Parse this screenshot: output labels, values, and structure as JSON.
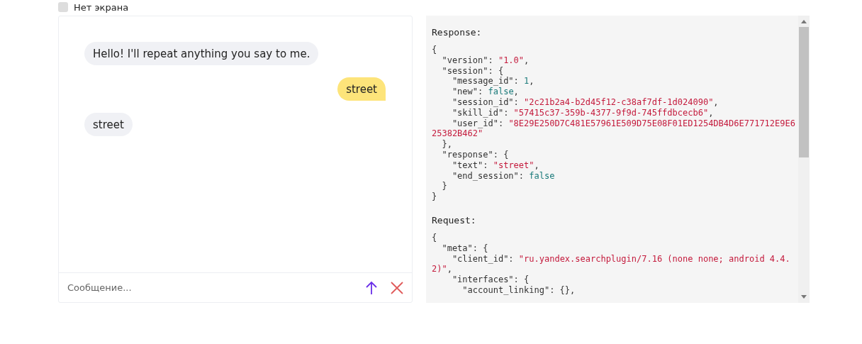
{
  "no_screen_option": {
    "label": "Нет экрана",
    "checked": false
  },
  "chat": {
    "messages": [
      {
        "kind": "skill",
        "text": "Hello! I'll repeat anything you say to me."
      },
      {
        "kind": "user",
        "text": "street"
      },
      {
        "kind": "skill",
        "text": "street"
      }
    ],
    "input": {
      "placeholder": "Сообщение..."
    }
  },
  "log": {
    "sections": [
      {
        "title": "Response:",
        "lines": [
          [
            {
              "kind": "punct",
              "text": "{"
            }
          ],
          [
            {
              "kind": "punct",
              "text": "  \"version\": "
            },
            {
              "kind": "string",
              "text": "\"1.0\""
            },
            {
              "kind": "punct",
              "text": ","
            }
          ],
          [
            {
              "kind": "punct",
              "text": "  \"session\": {"
            }
          ],
          [
            {
              "kind": "punct",
              "text": "    \"message_id\": "
            },
            {
              "kind": "number",
              "text": "1"
            },
            {
              "kind": "punct",
              "text": ","
            }
          ],
          [
            {
              "kind": "punct",
              "text": "    \"new\": "
            },
            {
              "kind": "bool",
              "text": "false"
            },
            {
              "kind": "punct",
              "text": ","
            }
          ],
          [
            {
              "kind": "punct",
              "text": "    \"session_id\": "
            },
            {
              "kind": "string",
              "text": "\"2c21b2a4-b2d45f12-c38af7df-1d024090\""
            },
            {
              "kind": "punct",
              "text": ","
            }
          ],
          [
            {
              "kind": "punct",
              "text": "    \"skill_id\": "
            },
            {
              "kind": "string",
              "text": "\"57415c37-359b-4377-9f9d-745ffdbcecb6\""
            },
            {
              "kind": "punct",
              "text": ","
            }
          ],
          [
            {
              "kind": "punct",
              "text": "    \"user_id\": "
            },
            {
              "kind": "string",
              "text": "\"8E29E250D7C481E57961E509D75E08F01ED1254DB4D6E771712E9E6"
            }
          ],
          [
            {
              "kind": "string",
              "text": "25382B462\""
            }
          ],
          [
            {
              "kind": "punct",
              "text": "  },"
            }
          ],
          [
            {
              "kind": "punct",
              "text": "  \"response\": {"
            }
          ],
          [
            {
              "kind": "punct",
              "text": "    \"text\": "
            },
            {
              "kind": "string",
              "text": "\"street\""
            },
            {
              "kind": "punct",
              "text": ","
            }
          ],
          [
            {
              "kind": "punct",
              "text": "    \"end_session\": "
            },
            {
              "kind": "bool",
              "text": "false"
            }
          ],
          [
            {
              "kind": "punct",
              "text": "  }"
            }
          ],
          [
            {
              "kind": "punct",
              "text": "}"
            }
          ]
        ]
      },
      {
        "title": "Request:",
        "lines": [
          [
            {
              "kind": "punct",
              "text": "{"
            }
          ],
          [
            {
              "kind": "punct",
              "text": "  \"meta\": {"
            }
          ],
          [
            {
              "kind": "punct",
              "text": "    \"client_id\": "
            },
            {
              "kind": "string",
              "text": "\"ru.yandex.searchplugin/7.16 (none none; android 4.4."
            }
          ],
          [
            {
              "kind": "string",
              "text": "2)\""
            },
            {
              "kind": "punct",
              "text": ","
            }
          ],
          [
            {
              "kind": "punct",
              "text": "    \"interfaces\": {"
            }
          ],
          [
            {
              "kind": "punct",
              "text": "      \"account_linking\": {},"
            }
          ]
        ]
      }
    ]
  }
}
